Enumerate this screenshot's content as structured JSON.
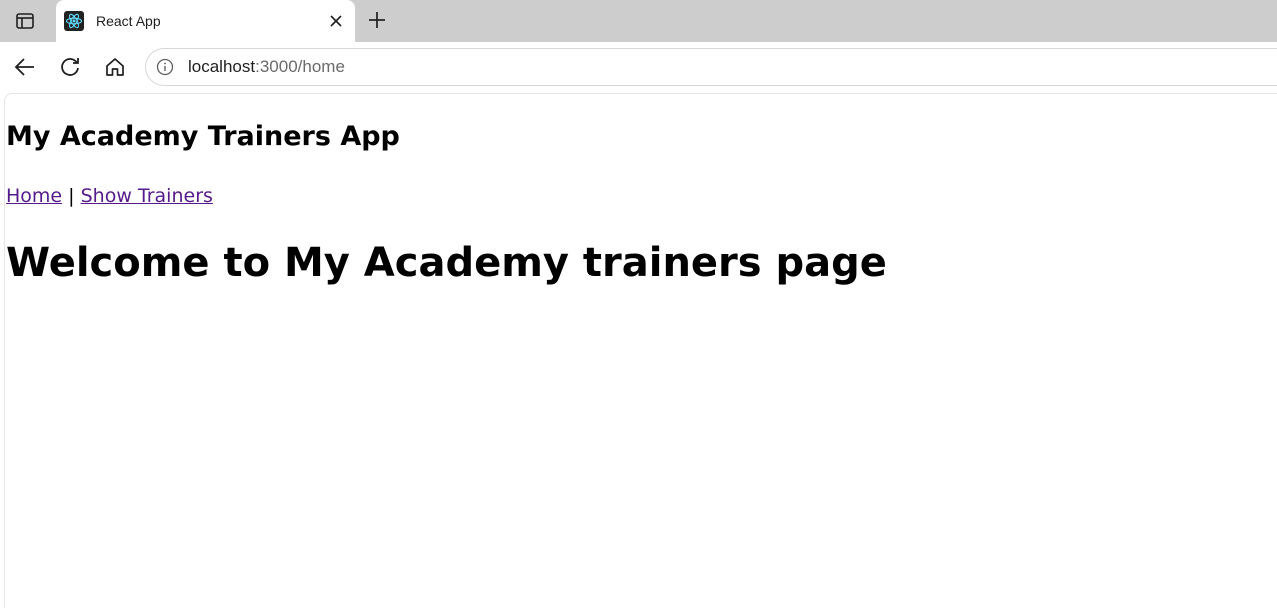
{
  "browser": {
    "tab": {
      "title": "React App",
      "favicon": "react-logo-icon"
    },
    "address": {
      "host": "localhost",
      "path": ":3000/home"
    },
    "icons": {
      "sidebar": "sidebar-toggle-icon",
      "close": "close-icon",
      "new_tab": "plus-icon",
      "back": "back-arrow-icon",
      "reload": "reload-icon",
      "home": "home-icon",
      "info": "info-icon"
    }
  },
  "page": {
    "app_title": "My Academy Trainers App",
    "nav": {
      "home": "Home",
      "separator": "|",
      "show_trainers": "Show Trainers"
    },
    "heading": "Welcome to My Academy trainers page"
  },
  "colors": {
    "tabstrip": "#cdcdcd",
    "visited_link": "#551a8b",
    "react_cyan": "#61dafb"
  }
}
